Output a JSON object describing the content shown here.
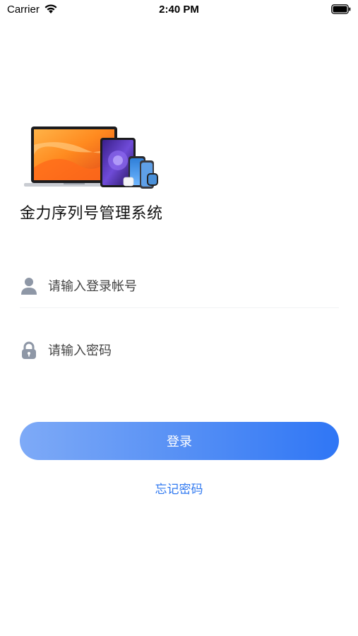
{
  "status_bar": {
    "carrier": "Carrier",
    "time": "2:40 PM",
    "wifi_icon": "wifi-icon",
    "battery_icon": "battery-icon"
  },
  "hero": {
    "image": "apple-devices-illustration"
  },
  "app": {
    "title": "金力序列号管理系统"
  },
  "login_form": {
    "account": {
      "icon": "user-icon",
      "placeholder": "请输入登录帐号",
      "value": ""
    },
    "password": {
      "icon": "lock-icon",
      "placeholder": "请输入密码",
      "value": ""
    },
    "login_label": "登录",
    "forgot_label": "忘记密码"
  },
  "colors": {
    "accent": "#2f76f5",
    "accent_light": "#7eaaf7",
    "link": "#2f78f0",
    "icon_gray": "#8e97a6"
  }
}
